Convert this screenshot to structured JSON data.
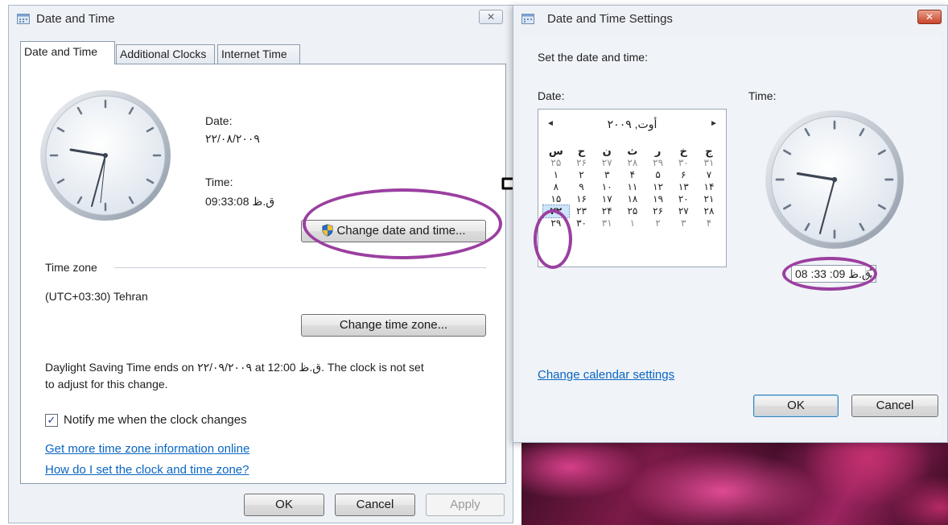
{
  "left_window": {
    "title": "Date and Time",
    "close_label": "✕",
    "tabs": [
      {
        "label": "Date and Time",
        "active": true
      },
      {
        "label": "Additional Clocks",
        "active": false
      },
      {
        "label": "Internet Time",
        "active": false
      }
    ],
    "date_label": "Date:",
    "date_value": "۲۲/۰۸/۲۰۰۹",
    "time_label": "Time:",
    "time_value": "ق.ظ 09:33:08",
    "change_datetime_button": "Change date and time...",
    "timezone_heading": "Time zone",
    "timezone_value": "(UTC+03:30) Tehran",
    "change_timezone_button": "Change time zone...",
    "dst_line1": "Daylight Saving Time ends on ۲۲/۰۹/۲۰۰۹ at 12:00 ق.ظ. The clock is not set",
    "dst_line2": "to adjust for this change.",
    "notify_label": "Notify me when the clock changes",
    "notify_checked": true,
    "link_more_info": "Get more time zone information online",
    "link_how_to": "How do I set the clock and time zone?",
    "ok_button": "OK",
    "cancel_button": "Cancel",
    "apply_button": "Apply"
  },
  "right_window": {
    "title": "Date and Time Settings",
    "close_label": "✕",
    "instruction": "Set the date and time:",
    "date_label": "Date:",
    "time_label": "Time:",
    "calendar": {
      "month_title": "أوت, ۲۰۰۹",
      "prev": "◄",
      "next": "►",
      "weekday_headers": [
        "ج",
        "خ",
        "ر",
        "ث",
        "ن",
        "ح",
        "س"
      ],
      "weeks": [
        [
          "۳۱",
          "۳۰",
          "۲۹",
          "۲۸",
          "۲۷",
          "۲۶",
          "۲۵"
        ],
        [
          "۷",
          "۶",
          "۵",
          "۴",
          "۳",
          "۲",
          "۱"
        ],
        [
          "۱۴",
          "۱۳",
          "۱۲",
          "۱۱",
          "۱۰",
          "۹",
          "۸"
        ],
        [
          "۲۱",
          "۲۰",
          "۱۹",
          "۱۸",
          "۱۷",
          "۱۶",
          "۱۵"
        ],
        [
          "۲۸",
          "۲۷",
          "۲۶",
          "۲۵",
          "۲۴",
          "۲۳",
          "۲۲"
        ],
        [
          "۴",
          "۳",
          "۲",
          "۱",
          "۳۱",
          "۳۰",
          "۲۹"
        ]
      ],
      "selected": "۲۲"
    },
    "time_value": "ق.ظ 09: 33: 08",
    "link_calendar_settings": "Change calendar settings",
    "ok_button": "OK",
    "cancel_button": "Cancel"
  },
  "colors": {
    "highlight_oval": "#9b3fa0",
    "link": "#0a66c2"
  }
}
